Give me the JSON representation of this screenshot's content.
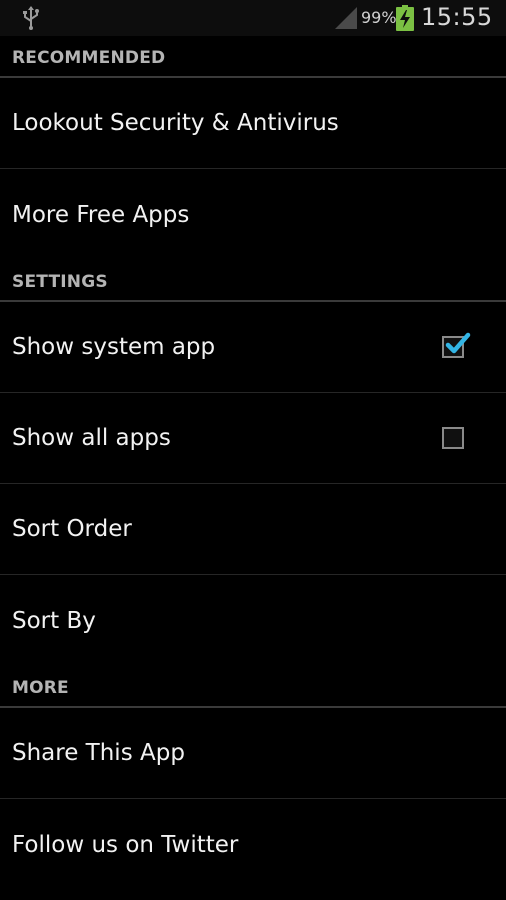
{
  "status_bar": {
    "battery_percent": "99%",
    "time": "15:55",
    "icons": [
      "usb-icon",
      "signal-icon",
      "battery-charging-icon"
    ]
  },
  "sections": {
    "recommended": {
      "header": "RECOMMENDED",
      "items": [
        "Lookout Security & Antivirus",
        "More Free Apps"
      ]
    },
    "settings": {
      "header": "SETTINGS",
      "show_system_app": {
        "label": "Show system app",
        "checked": true
      },
      "show_all_apps": {
        "label": "Show all apps",
        "checked": false
      },
      "sort_order": "Sort Order",
      "sort_by": "Sort By"
    },
    "more": {
      "header": "MORE",
      "items": [
        "Share This App",
        "Follow us on Twitter"
      ]
    }
  },
  "colors": {
    "background": "#000000",
    "accent_check": "#33b5e5",
    "header_text": "#b4b4b4"
  }
}
